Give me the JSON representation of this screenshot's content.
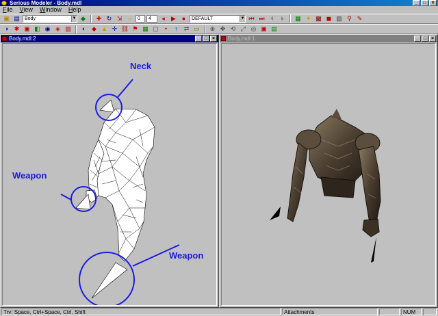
{
  "window": {
    "title": "Serious Modeler - Body.mdl"
  },
  "menu": [
    "File",
    "View",
    "Window",
    "Help"
  ],
  "toolbar": {
    "model_combo": "Body",
    "frame_from": "0",
    "frame_to": "4",
    "animation_combo": "DEFAULT"
  },
  "views": {
    "left": {
      "title": "Body.mdl:2"
    },
    "right": {
      "title": "Body.mdl:1"
    }
  },
  "annotations": {
    "neck": "Neck",
    "weapon_left": "Weapon",
    "weapon_bottom": "Weapon"
  },
  "colors": {
    "annotation": "#1a1ae6",
    "titlebar": "#000080",
    "viewport_bg": "#c0c0c0"
  },
  "statusbar": {
    "hint": "Trv: Space, Ctrl+Space, Ctrl, Shift",
    "attachments": "Attachments",
    "num": "NUM"
  }
}
